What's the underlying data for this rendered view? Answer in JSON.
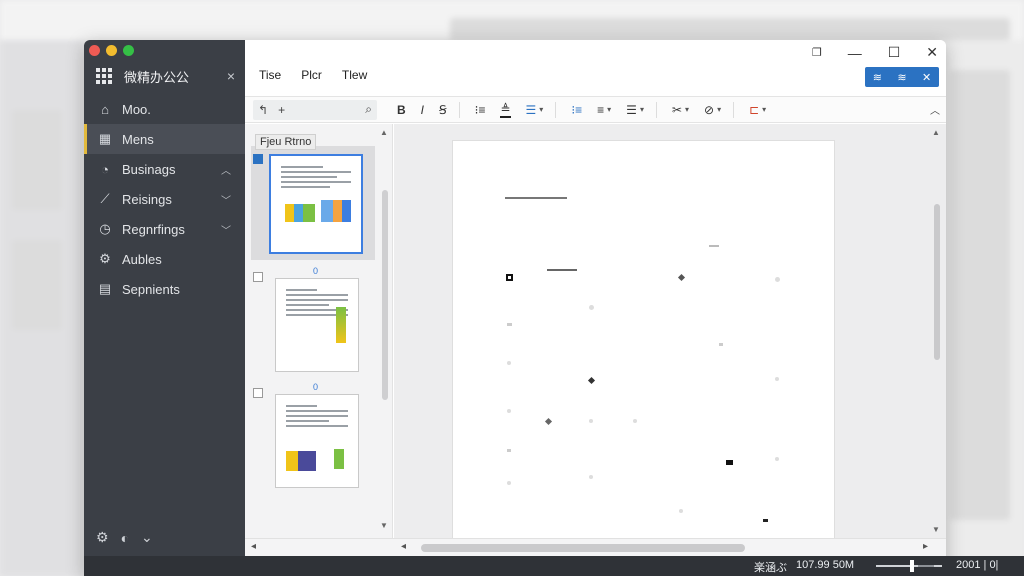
{
  "sidebar": {
    "app_title": "微精办公公",
    "close": "×",
    "items": [
      {
        "label": "Moo.",
        "icon": "home-icon",
        "glyph": "⌂",
        "chev": ""
      },
      {
        "label": "Mens",
        "icon": "dashboard-icon",
        "glyph": "▦",
        "chev": ""
      },
      {
        "label": "Businags",
        "icon": "pie-chart-icon",
        "glyph": "◔",
        "chev": "︿"
      },
      {
        "label": "Reisings",
        "icon": "line-chart-icon",
        "glyph": "⟋",
        "chev": "﹀"
      },
      {
        "label": "Regnrfings",
        "icon": "clock-icon",
        "glyph": "◷",
        "chev": "﹀"
      },
      {
        "label": "Aubles",
        "icon": "settings-gear-icon",
        "glyph": "⚙",
        "chev": ""
      },
      {
        "label": "Sepnients",
        "icon": "chart-box-icon",
        "glyph": "▤",
        "chev": ""
      }
    ],
    "footer": {
      "settings": "⚙",
      "theme": "◐",
      "more": "⌄"
    }
  },
  "window_controls": {
    "restore": "❐",
    "minimize": "—",
    "maximize": "☐",
    "close": "✕"
  },
  "menu": [
    "Tise",
    "Plcr",
    "Tlew"
  ],
  "accent_buttons": [
    "≋",
    "≋",
    "✕"
  ],
  "toolbar": {
    "undo": "↰",
    "add": "+",
    "search_icon": "⌕",
    "bold": "B",
    "italic": "I",
    "format": "Ꞩ",
    "list_num": "⁝≡",
    "align": "≜",
    "color_list": "☰",
    "bullets": "⁝≡",
    "numbering": "≡",
    "indent": "☰",
    "cut": "✂",
    "find": "⊘",
    "shape": "⊏",
    "collapse": "︿"
  },
  "thumbnails": {
    "tooltip": "Fjeu Rtrno",
    "pages": [
      {
        "num": "",
        "selected": true
      },
      {
        "num": "0",
        "selected": false
      },
      {
        "num": "0",
        "selected": false
      }
    ]
  },
  "statusbar": {
    "label": "楽涵ぶ",
    "size": "107.99 50M",
    "page": "2001 | 0|"
  },
  "colors": {
    "sidebar_bg": "#3b3f46",
    "accent": "#2b72c2",
    "active_marker": "#e2b93b",
    "statusbar_bg": "#2f3237"
  }
}
